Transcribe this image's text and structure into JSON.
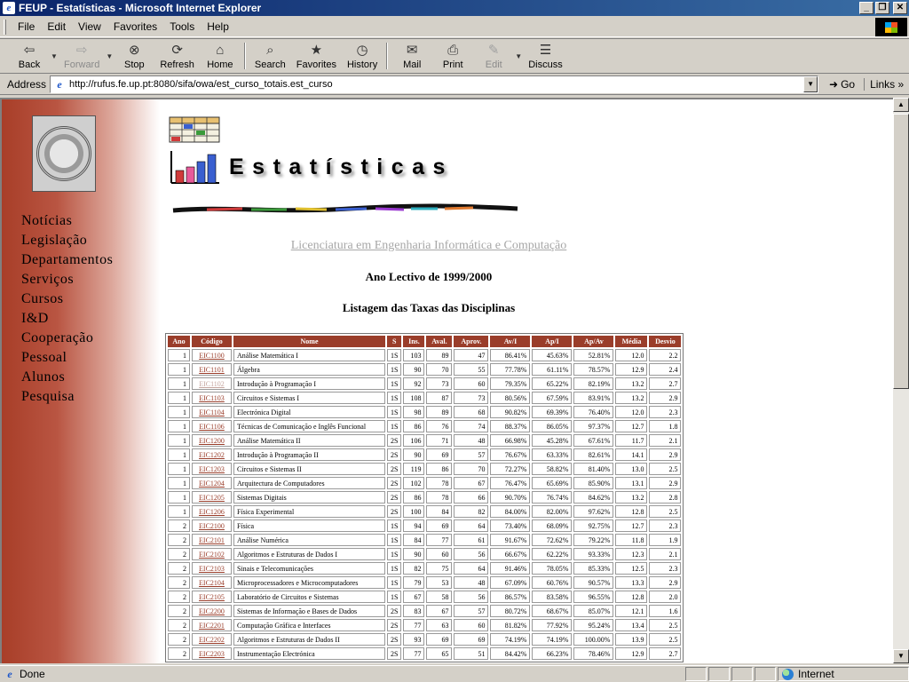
{
  "window": {
    "title": "FEUP - Estatísticas - Microsoft Internet Explorer",
    "minimize": "_",
    "maximize": "❐",
    "close": "✕"
  },
  "menu": [
    "File",
    "Edit",
    "View",
    "Favorites",
    "Tools",
    "Help"
  ],
  "toolbar": {
    "back": "Back",
    "forward": "Forward",
    "stop": "Stop",
    "refresh": "Refresh",
    "home": "Home",
    "search": "Search",
    "favorites": "Favorites",
    "history": "History",
    "mail": "Mail",
    "print": "Print",
    "edit": "Edit",
    "discuss": "Discuss"
  },
  "icons": {
    "back": "back-arrow-icon",
    "forward": "forward-arrow-icon",
    "stop": "stop-icon",
    "refresh": "refresh-icon",
    "home": "home-icon",
    "search": "search-icon",
    "favorites": "favorites-folder-icon",
    "history": "history-icon",
    "mail": "mail-icon",
    "print": "printer-icon",
    "edit": "edit-icon",
    "discuss": "discuss-icon"
  },
  "address": {
    "label": "Address",
    "url": "http://rufus.fe.up.pt:8080/sifa/owa/est_curso_totais.est_curso",
    "go": "Go",
    "links": "Links"
  },
  "sidebar": {
    "nav": [
      "Notícias",
      "Legislação",
      "Departamentos",
      "Serviços",
      "Cursos",
      "I&D",
      "Cooperação",
      "Pessoal",
      "Alunos",
      "Pesquisa"
    ]
  },
  "page": {
    "title": "Estatísticas",
    "course": "Licenciatura em Engenharia Informática e Computação",
    "year": "Ano Lectivo de 1999/2000",
    "listing": "Listagem das Taxas das Disciplinas"
  },
  "table": {
    "headers": [
      "Ano",
      "Código",
      "Nome",
      "S",
      "Ins.",
      "Aval.",
      "Aprov.",
      "Av/I",
      "Ap/I",
      "Ap/Av",
      "Média",
      "Desvio"
    ],
    "rows": [
      [
        "1",
        "EIC1100",
        "Análise Matemática I",
        "1S",
        "103",
        "89",
        "47",
        "86.41%",
        "45.63%",
        "52.81%",
        "12.0",
        "2.2"
      ],
      [
        "1",
        "EIC1101",
        "Álgebra",
        "1S",
        "90",
        "70",
        "55",
        "77.78%",
        "61.11%",
        "78.57%",
        "12.9",
        "2.4"
      ],
      [
        "1",
        "EIC1102",
        "Introdução à Programação I",
        "1S",
        "92",
        "73",
        "60",
        "79.35%",
        "65.22%",
        "82.19%",
        "13.2",
        "2.7"
      ],
      [
        "1",
        "EIC1103",
        "Circuitos e Sistemas I",
        "1S",
        "108",
        "87",
        "73",
        "80.56%",
        "67.59%",
        "83.91%",
        "13.2",
        "2.9"
      ],
      [
        "1",
        "EIC1104",
        "Electrónica Digital",
        "1S",
        "98",
        "89",
        "68",
        "90.82%",
        "69.39%",
        "76.40%",
        "12.0",
        "2.3"
      ],
      [
        "1",
        "EIC1106",
        "Técnicas de Comunicação e Inglês Funcional",
        "1S",
        "86",
        "76",
        "74",
        "88.37%",
        "86.05%",
        "97.37%",
        "12.7",
        "1.8"
      ],
      [
        "1",
        "EIC1200",
        "Análise Matemática II",
        "2S",
        "106",
        "71",
        "48",
        "66.98%",
        "45.28%",
        "67.61%",
        "11.7",
        "2.1"
      ],
      [
        "1",
        "EIC1202",
        "Introdução à Programação II",
        "2S",
        "90",
        "69",
        "57",
        "76.67%",
        "63.33%",
        "82.61%",
        "14.1",
        "2.9"
      ],
      [
        "1",
        "EIC1203",
        "Circuitos e Sistemas II",
        "2S",
        "119",
        "86",
        "70",
        "72.27%",
        "58.82%",
        "81.40%",
        "13.0",
        "2.5"
      ],
      [
        "1",
        "EIC1204",
        "Arquitectura de Computadores",
        "2S",
        "102",
        "78",
        "67",
        "76.47%",
        "65.69%",
        "85.90%",
        "13.1",
        "2.9"
      ],
      [
        "1",
        "EIC1205",
        "Sistemas Digitais",
        "2S",
        "86",
        "78",
        "66",
        "90.70%",
        "76.74%",
        "84.62%",
        "13.2",
        "2.8"
      ],
      [
        "1",
        "EIC1206",
        "Física Experimental",
        "2S",
        "100",
        "84",
        "82",
        "84.00%",
        "82.00%",
        "97.62%",
        "12.8",
        "2.5"
      ],
      [
        "2",
        "EIC2100",
        "Física",
        "1S",
        "94",
        "69",
        "64",
        "73.40%",
        "68.09%",
        "92.75%",
        "12.7",
        "2.3"
      ],
      [
        "2",
        "EIC2101",
        "Análise Numérica",
        "1S",
        "84",
        "77",
        "61",
        "91.67%",
        "72.62%",
        "79.22%",
        "11.8",
        "1.9"
      ],
      [
        "2",
        "EIC2102",
        "Algoritmos e Estruturas de Dados I",
        "1S",
        "90",
        "60",
        "56",
        "66.67%",
        "62.22%",
        "93.33%",
        "12.3",
        "2.1"
      ],
      [
        "2",
        "EIC2103",
        "Sinais e Telecomunicações",
        "1S",
        "82",
        "75",
        "64",
        "91.46%",
        "78.05%",
        "85.33%",
        "12.5",
        "2.3"
      ],
      [
        "2",
        "EIC2104",
        "Microprocessadores e Microcomputadores",
        "1S",
        "79",
        "53",
        "48",
        "67.09%",
        "60.76%",
        "90.57%",
        "13.3",
        "2.9"
      ],
      [
        "2",
        "EIC2105",
        "Laboratório de Circuitos e Sistemas",
        "1S",
        "67",
        "58",
        "56",
        "86.57%",
        "83.58%",
        "96.55%",
        "12.8",
        "2.0"
      ],
      [
        "2",
        "EIC2200",
        "Sistemas de Informação e Bases de Dados",
        "2S",
        "83",
        "67",
        "57",
        "80.72%",
        "68.67%",
        "85.07%",
        "12.1",
        "1.6"
      ],
      [
        "2",
        "EIC2201",
        "Computação Gráfica e Interfaces",
        "2S",
        "77",
        "63",
        "60",
        "81.82%",
        "77.92%",
        "95.24%",
        "13.4",
        "2.5"
      ],
      [
        "2",
        "EIC2202",
        "Algoritmos e Estruturas de Dados II",
        "2S",
        "93",
        "69",
        "69",
        "74.19%",
        "74.19%",
        "100.00%",
        "13.9",
        "2.5"
      ],
      [
        "2",
        "EIC2203",
        "Instrumentação Electrónica",
        "2S",
        "77",
        "65",
        "51",
        "84.42%",
        "66.23%",
        "78.46%",
        "12.9",
        "2.7"
      ]
    ]
  },
  "status": {
    "text": "Done",
    "zone": "Internet"
  },
  "colors": {
    "accent": "#9a3d2a",
    "sidebar_gradient_start": "#a83e28",
    "course_link": "#a7a7a7",
    "titlebar": "#0a246a"
  }
}
